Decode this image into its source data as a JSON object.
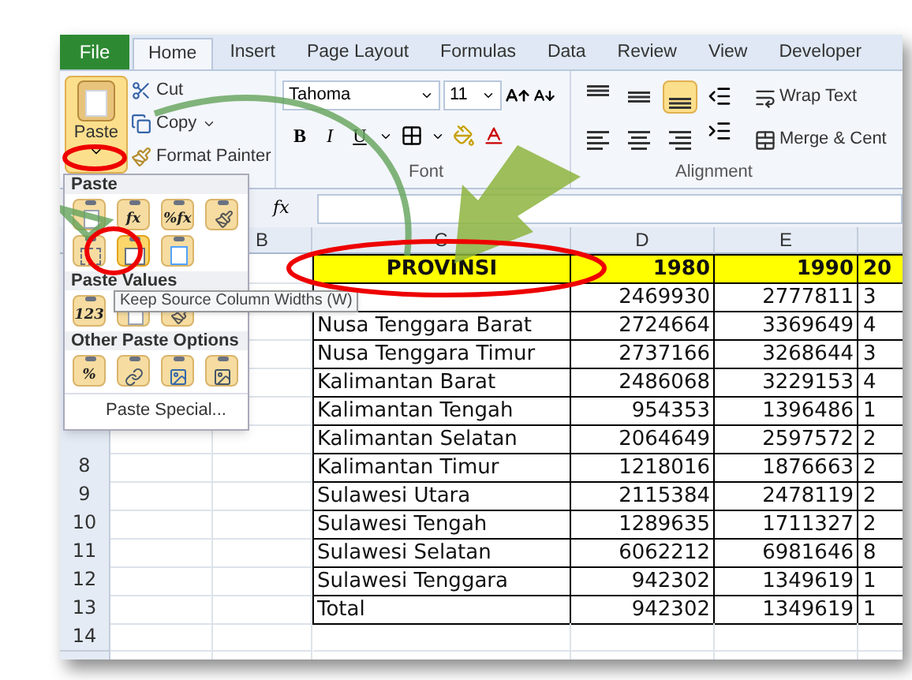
{
  "tabs": [
    {
      "label": "File",
      "kind": "file",
      "selected": false
    },
    {
      "label": "Home",
      "kind": "tab",
      "selected": true
    },
    {
      "label": "Insert",
      "kind": "tab",
      "selected": false
    },
    {
      "label": "Page Layout",
      "kind": "tab",
      "selected": false
    },
    {
      "label": "Formulas",
      "kind": "tab",
      "selected": false
    },
    {
      "label": "Data",
      "kind": "tab",
      "selected": false
    },
    {
      "label": "Review",
      "kind": "tab",
      "selected": false
    },
    {
      "label": "View",
      "kind": "tab",
      "selected": false
    },
    {
      "label": "Developer",
      "kind": "tab",
      "selected": false
    }
  ],
  "clipboard": {
    "paste_label": "Paste",
    "paste_pressed": true,
    "actions": [
      {
        "label": "Cut",
        "kind": "cut",
        "dropdown": false
      },
      {
        "label": "Copy",
        "kind": "copy",
        "dropdown": true
      },
      {
        "label": "Format Painter",
        "kind": "painter",
        "dropdown": false
      }
    ]
  },
  "font": {
    "font_name": "Tahoma",
    "font_size": "11",
    "style_buttons": [
      "B",
      "I",
      "U"
    ],
    "group_label": "Font"
  },
  "alignment": {
    "buttons": [
      {
        "kind": "top",
        "selected": false
      },
      {
        "kind": "middle",
        "selected": false
      },
      {
        "kind": "bottom",
        "selected": true
      },
      {
        "kind": "left",
        "selected": false
      },
      {
        "kind": "center",
        "selected": false
      },
      {
        "kind": "right",
        "selected": false
      }
    ],
    "wrap_text": "Wrap Text",
    "merge": "Merge & Cent",
    "group_label": "Alignment"
  },
  "formula_bar": {
    "fx_label": "fx"
  },
  "sheet": {
    "column_headers": [
      "B",
      "C",
      "D",
      "E"
    ],
    "rows": [
      {
        "kind": "header",
        "province": "PROVINSI",
        "y1980": "1980",
        "y1990": "1990",
        "column_6": "20"
      },
      {
        "kind": "data",
        "y1980": "2469930",
        "y1990": "2777811",
        "column_6": "3"
      },
      {
        "kind": "data",
        "province": "Nusa Tenggara Barat",
        "y1980": "2724664",
        "y1990": "3369649",
        "column_6": "4"
      },
      {
        "kind": "data",
        "province": "Nusa Tenggara Timur",
        "y1980": "2737166",
        "y1990": "3268644",
        "column_6": "3"
      },
      {
        "kind": "data",
        "province": "Kalimantan Barat",
        "y1980": "2486068",
        "y1990": "3229153",
        "column_6": "4"
      },
      {
        "kind": "data",
        "province": "Kalimantan Tengah",
        "y1980": "954353",
        "y1990": "1396486",
        "column_6": "1"
      },
      {
        "kind": "data",
        "province": "Kalimantan Selatan",
        "y1980": "2064649",
        "y1990": "2597572",
        "column_6": "2"
      },
      {
        "kind": "data",
        "number": "8",
        "province": "Kalimantan Timur",
        "y1980": "1218016",
        "y1990": "1876663",
        "column_6": "2"
      },
      {
        "kind": "data",
        "number": "9",
        "province": "Sulawesi Utara",
        "y1980": "2115384",
        "y1990": "2478119",
        "column_6": "2"
      },
      {
        "kind": "data",
        "number": "10",
        "province": "Sulawesi Tengah",
        "y1980": "1289635",
        "y1990": "1711327",
        "column_6": "2"
      },
      {
        "kind": "data",
        "number": "11",
        "province": "Sulawesi Selatan",
        "y1980": "6062212",
        "y1990": "6981646",
        "column_6": "8"
      },
      {
        "kind": "data",
        "number": "12",
        "province": "Sulawesi Tenggara",
        "y1980": "942302",
        "y1990": "1349619",
        "column_6": "1"
      },
      {
        "kind": "data",
        "number": "13",
        "province": "Total",
        "y1980": "942302",
        "y1990": "1349619",
        "column_6": "1"
      },
      {
        "kind": "empty",
        "number": "14"
      },
      {
        "kind": "empty"
      }
    ]
  },
  "paste_menu": {
    "sections": [
      {
        "heading": "Paste",
        "options": [
          {
            "kind": "paste",
            "selected": false
          },
          {
            "kind": "glyph",
            "glyph": "fx",
            "selected": false
          },
          {
            "kind": "glyph",
            "glyph": "%fx",
            "selected": false
          },
          {
            "kind": "brush",
            "selected": false
          },
          {
            "kind": "borders",
            "selected": false
          },
          {
            "kind": "widths",
            "selected": true
          },
          {
            "kind": "transpose",
            "selected": false
          }
        ]
      },
      {
        "heading": "Paste Values",
        "options": [
          {
            "kind": "glyph",
            "glyph": "123",
            "selected": false
          },
          {
            "kind": "paste",
            "selected": false
          },
          {
            "kind": "brush",
            "selected": false
          }
        ]
      },
      {
        "heading": "Other Paste Options",
        "options": [
          {
            "kind": "glyph",
            "glyph": "%",
            "selected": false
          },
          {
            "kind": "link",
            "selected": false
          },
          {
            "kind": "picture",
            "selected": false
          },
          {
            "kind": "linkpicture",
            "selected": false
          }
        ]
      }
    ],
    "special": "Paste Special..."
  },
  "tooltip": "Keep Source Column Widths (W)"
}
